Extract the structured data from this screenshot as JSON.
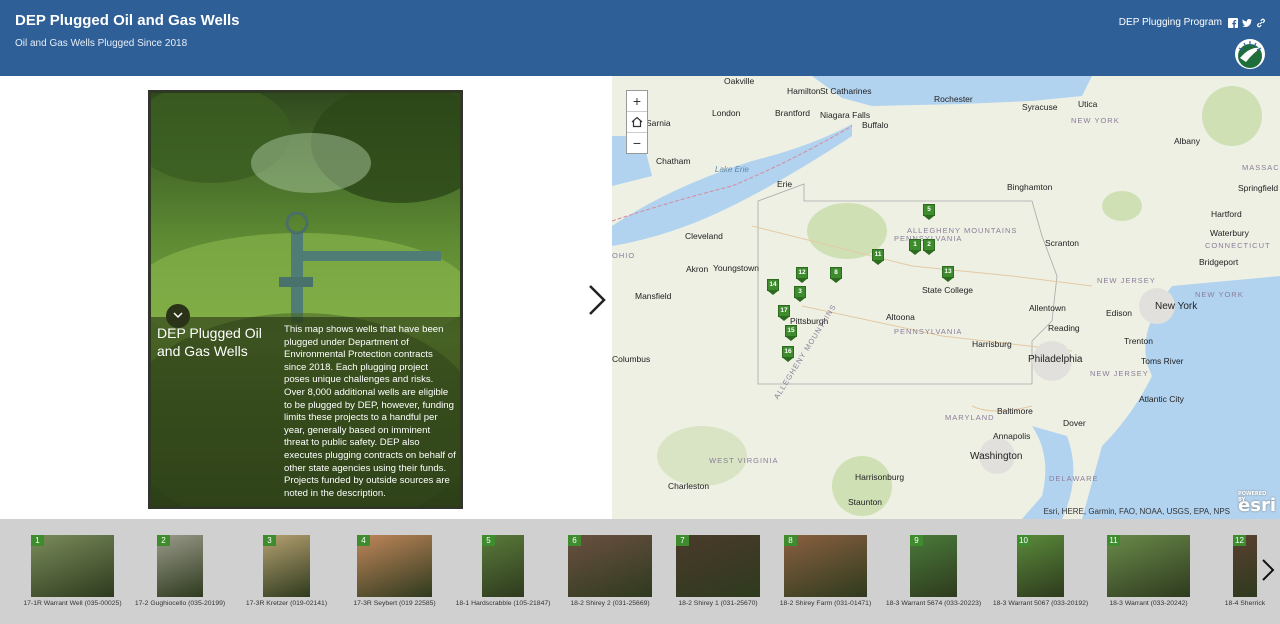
{
  "header": {
    "title": "DEP Plugged Oil and Gas Wells",
    "subtitle": "Oil and Gas Wells Plugged Since 2018",
    "link": "DEP Plugging Program",
    "icons": [
      "facebook-icon",
      "twitter-icon",
      "link-icon"
    ]
  },
  "panel": {
    "title": "DEP Plugged Oil and Gas Wells",
    "description": "This map shows wells that have been plugged under Department of Environmental Protection contracts since 2018. Each plugging project poses unique challenges and risks. Over 8,000 additional wells are eligible to be plugged by DEP, however, funding limits these projects to a handful per year, generally based on imminent threat to public safety. DEP also executes plugging contracts on behalf of other state agencies using their funds. Projects funded by outside sources are noted in the description."
  },
  "map": {
    "zoom_in": "+",
    "zoom_out": "−",
    "attribution": "Esri, HERE, Garmin, FAO, NOAA, USGS, EPA, NPS",
    "esri_logo": "esri",
    "esri_powered": "POWERED BY",
    "labels": [
      {
        "t": "Oakville",
        "c": "city"
      },
      {
        "t": "Hamilton",
        "c": "city"
      },
      {
        "t": "St Catharines",
        "c": "city"
      },
      {
        "t": "Rochester",
        "c": "city"
      },
      {
        "t": "Syracuse",
        "c": "city"
      },
      {
        "t": "Utica",
        "c": "city"
      },
      {
        "t": "London",
        "c": "city"
      },
      {
        "t": "Brantford",
        "c": "city"
      },
      {
        "t": "Niagara Falls",
        "c": "city"
      },
      {
        "t": "Buffalo",
        "c": "city"
      },
      {
        "t": "Sarnia",
        "c": "city"
      },
      {
        "t": "NEW YORK",
        "c": "state"
      },
      {
        "t": "Albany",
        "c": "city"
      },
      {
        "t": "Chatham",
        "c": "city"
      },
      {
        "t": "Lake Erie",
        "c": "water"
      },
      {
        "t": "Erie",
        "c": "city"
      },
      {
        "t": "Binghamton",
        "c": "city"
      },
      {
        "t": "Cleveland",
        "c": "city"
      },
      {
        "t": "ALLEGHENY MOUNTAINS",
        "c": "state"
      },
      {
        "t": "PENNSYLVANIA",
        "c": "state"
      },
      {
        "t": "Scranton",
        "c": "city"
      },
      {
        "t": "Hartford",
        "c": "city"
      },
      {
        "t": "Waterbury",
        "c": "city"
      },
      {
        "t": "Akron",
        "c": "city"
      },
      {
        "t": "Youngstown",
        "c": "city"
      },
      {
        "t": "Bridgeport",
        "c": "city"
      },
      {
        "t": "NEW JERSEY",
        "c": "state"
      },
      {
        "t": "Mansfield",
        "c": "city"
      },
      {
        "t": "State College",
        "c": "city"
      },
      {
        "t": "NEW YORK",
        "c": "state"
      },
      {
        "t": "Allentown",
        "c": "city"
      },
      {
        "t": "New York",
        "c": "big"
      },
      {
        "t": "Pittsburgh",
        "c": "city"
      },
      {
        "t": "Altoona",
        "c": "city"
      },
      {
        "t": "Edison",
        "c": "city"
      },
      {
        "t": "Reading",
        "c": "city"
      },
      {
        "t": "PENNSYLVANIA",
        "c": "state"
      },
      {
        "t": "Harrisburg",
        "c": "city"
      },
      {
        "t": "Trenton",
        "c": "city"
      },
      {
        "t": "Columbus",
        "c": "city"
      },
      {
        "t": "Philadelphia",
        "c": "big"
      },
      {
        "t": "Toms River",
        "c": "city"
      },
      {
        "t": "NEW JERSEY",
        "c": "state"
      },
      {
        "t": "Atlantic City",
        "c": "city"
      },
      {
        "t": "MARYLAND",
        "c": "state"
      },
      {
        "t": "Baltimore",
        "c": "city"
      },
      {
        "t": "Dover",
        "c": "city"
      },
      {
        "t": "Annapolis",
        "c": "city"
      },
      {
        "t": "Washington",
        "c": "big"
      },
      {
        "t": "WEST VIRGINIA",
        "c": "state"
      },
      {
        "t": "Harrisonburg",
        "c": "city"
      },
      {
        "t": "DELAWARE",
        "c": "state"
      },
      {
        "t": "Charleston",
        "c": "city"
      },
      {
        "t": "Staunton",
        "c": "city"
      },
      {
        "t": "ALLEGHENY MOUNTAINS",
        "c": "state"
      },
      {
        "t": "Springfield",
        "c": "city"
      },
      {
        "t": "CONNECTICUT",
        "c": "state"
      },
      {
        "t": "MASSACH",
        "c": "state"
      },
      {
        "t": "OHIO",
        "c": "state"
      }
    ],
    "markers": [
      "5",
      "11",
      "1",
      "2",
      "8",
      "12",
      "14",
      "13",
      "3",
      "17",
      "15",
      "16"
    ]
  },
  "carousel": {
    "items": [
      {
        "num": "1",
        "label": "17-1R Warrant Well (035-00025)"
      },
      {
        "num": "2",
        "label": "17-2 Gughiocello (035-20199)"
      },
      {
        "num": "3",
        "label": "17-3R Kretzer (019-02141)"
      },
      {
        "num": "4",
        "label": "17-3R Seybert (019 22585)"
      },
      {
        "num": "5",
        "label": "18-1 Hardscrabble (105-21847)"
      },
      {
        "num": "6",
        "label": "18-2 Shirey 2 (031-25669)"
      },
      {
        "num": "7",
        "label": "18-2 Shirey 1 (031-25670)"
      },
      {
        "num": "8",
        "label": "18-2 Shirey Farm (031-01471)"
      },
      {
        "num": "9",
        "label": "18-3 Warrant 5674 (033-20223)"
      },
      {
        "num": "10",
        "label": "18-3 Warrant 5067 (033-20192)"
      },
      {
        "num": "11",
        "label": "18-3 Warrant (033-20242)"
      },
      {
        "num": "12",
        "label": "18-4 Sherrick"
      }
    ]
  },
  "colors": {
    "header": "#2f5f97",
    "marker": "#3f8c2f",
    "carousel": "#d0d0d0"
  }
}
